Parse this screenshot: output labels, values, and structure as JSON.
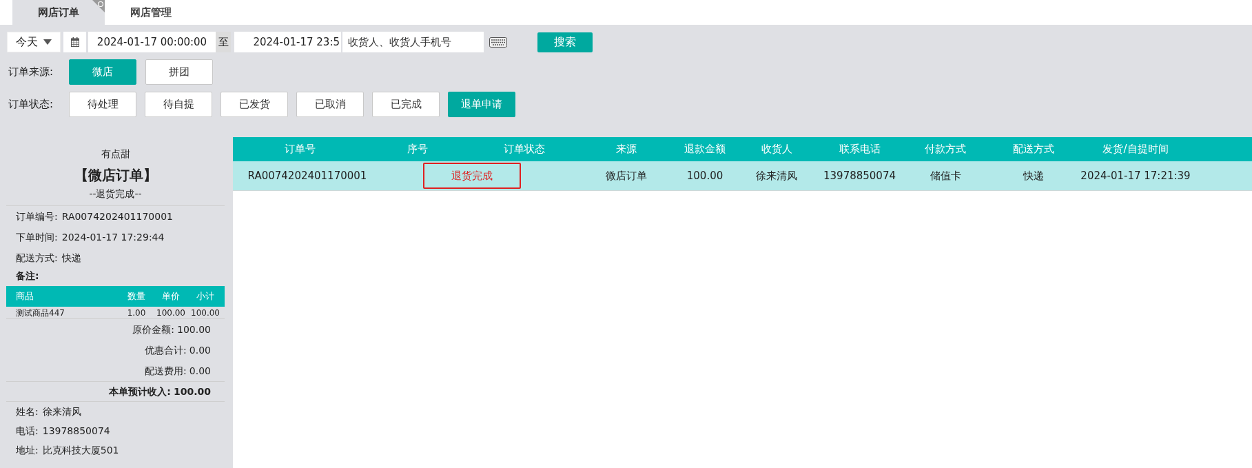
{
  "tabs": [
    {
      "label": "网店订单",
      "selected": true
    },
    {
      "label": "网店管理",
      "selected": false
    }
  ],
  "filters": {
    "period": "今天",
    "start_date": "2024-01-17 00:00:00",
    "to": "至",
    "end_date": "2024-01-17 23:5",
    "search": {
      "placeholder": "收货人、收货人手机号"
    },
    "search_button": "搜索",
    "source_label": "订单来源:",
    "sources": [
      {
        "label": "微店",
        "selected": true
      },
      {
        "label": "拼团",
        "selected": false
      }
    ],
    "status_label": "订单状态:",
    "statuses": [
      {
        "label": "待处理",
        "selected": false
      },
      {
        "label": "待自提",
        "selected": false
      },
      {
        "label": "已发货",
        "selected": false
      },
      {
        "label": "已取消",
        "selected": false
      },
      {
        "label": "已完成",
        "selected": false
      },
      {
        "label": "退单申请",
        "selected": true
      }
    ]
  },
  "receipt": {
    "shop": "有点甜",
    "title": "【微店订单】",
    "status": "--退货完成--",
    "info": [
      {
        "label": "订单编号:",
        "value": "RA0074202401170001"
      },
      {
        "label": "下单时间:",
        "value": "2024-01-17 17:29:44"
      },
      {
        "label": "配送方式:",
        "value": "快递"
      }
    ],
    "note": "备注:",
    "item_columns": [
      "商品",
      "数量",
      "单价",
      "小计"
    ],
    "items": [
      [
        "测试商品447",
        "1.00",
        "100.00",
        "100.00"
      ]
    ],
    "totals": [
      {
        "label": "原价金额:",
        "value": "100.00"
      },
      {
        "label": "优惠合计:",
        "value": "0.00"
      },
      {
        "label": "配送费用:",
        "value": "0.00"
      }
    ],
    "income": {
      "label": "本单预计收入:",
      "value": "100.00"
    },
    "customer": [
      {
        "label": "姓名:",
        "value": "徐来清风"
      },
      {
        "label": "电话:",
        "value": "13978850074"
      },
      {
        "label": "地址:",
        "value": "比克科技大厦501"
      }
    ]
  },
  "table": {
    "columns": [
      "订单号",
      "序号",
      "订单状态",
      "来源",
      "退款金额",
      "收货人",
      "联系电话",
      "付款方式",
      "配送方式",
      "发货/自提时间"
    ],
    "rows": [
      {
        "selected": true,
        "order_no": "RA0074202401170001",
        "status": "退货完成",
        "source": "微店订单",
        "refund": "100.00",
        "receiver": "徐来清风",
        "phone": "13978850074",
        "payment": "储值卡",
        "delivery": "快递",
        "time": "2024-01-17 17:21:39"
      }
    ]
  }
}
